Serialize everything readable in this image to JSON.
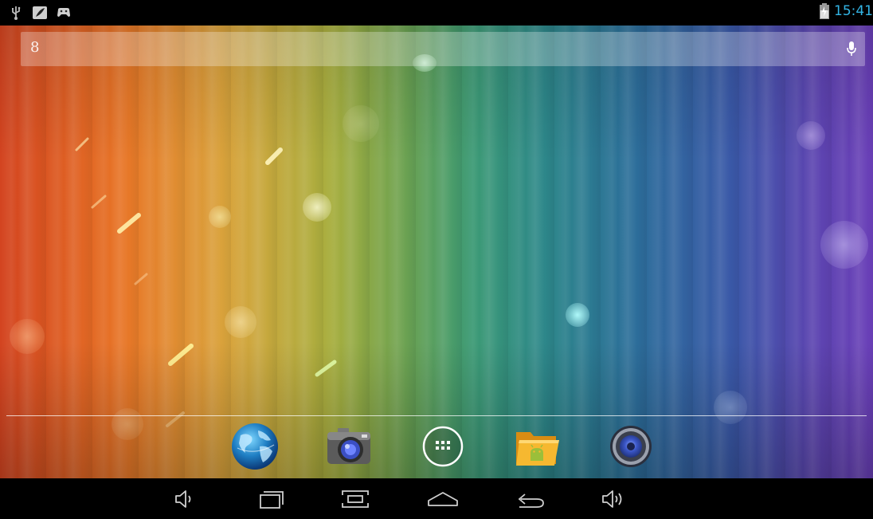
{
  "status_bar": {
    "time": "15:41",
    "left_icons": [
      "usb-icon",
      "notification-feather-icon",
      "gamepad-icon"
    ],
    "right_icons": [
      "battery-charging-icon"
    ],
    "accent_color": "#33b5e5"
  },
  "search_bar": {
    "left_icon": "google-search-icon",
    "right_icon": "microphone-icon",
    "google_glyph": "8"
  },
  "dock": {
    "items": [
      {
        "name": "browser-globe-icon"
      },
      {
        "name": "camera-icon"
      },
      {
        "name": "app-drawer-icon"
      },
      {
        "name": "file-manager-icon"
      },
      {
        "name": "music-speaker-icon"
      }
    ]
  },
  "navigation_bar": {
    "buttons": [
      {
        "name": "volume-down-icon"
      },
      {
        "name": "recent-apps-icon"
      },
      {
        "name": "screenshot-icon"
      },
      {
        "name": "home-icon"
      },
      {
        "name": "back-icon"
      },
      {
        "name": "volume-up-icon"
      }
    ]
  }
}
